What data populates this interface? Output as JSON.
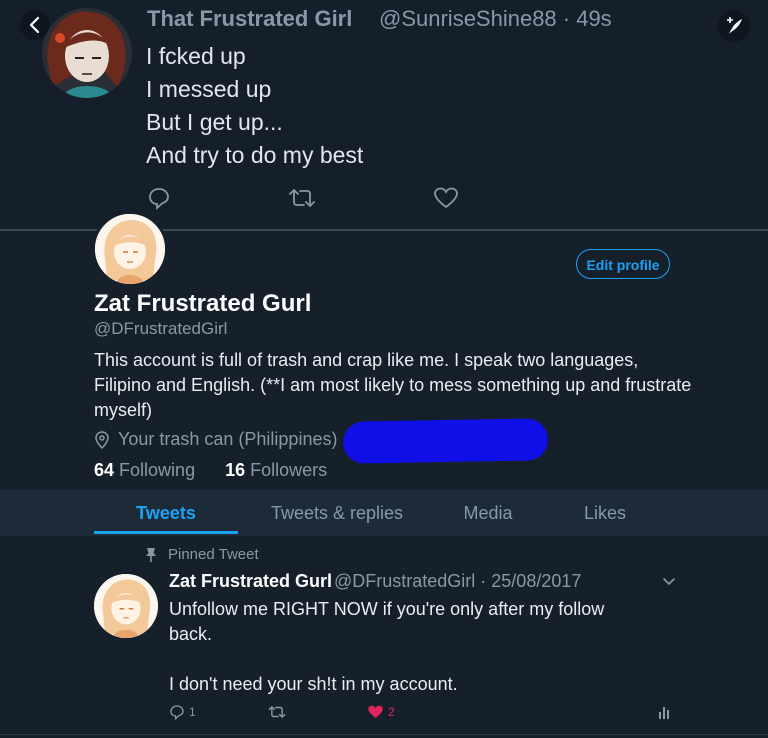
{
  "top_tweet": {
    "author_name": "That Frustrated Girl",
    "handle_time": "@SunriseShine88 · 49s",
    "text": "I fcked up\nI messed up\nBut I get up...\nAnd try to do my best"
  },
  "profile": {
    "display_name": "Zat Frustrated Gurl",
    "handle": "@DFrustratedGirl",
    "bio": "This account is full of trash and crap like me. I speak two languages, Filipino and English. (**I am most likely to mess something up and frustrate myself)",
    "location": "Your trash can (Philippines)",
    "following_count": "64",
    "following_label": "Following",
    "followers_count": "16",
    "followers_label": "Followers",
    "edit_profile_label": "Edit profile"
  },
  "tabs": [
    {
      "label": "Tweets",
      "active": true
    },
    {
      "label": "Tweets & replies",
      "active": false
    },
    {
      "label": "Media",
      "active": false
    },
    {
      "label": "Likes",
      "active": false
    }
  ],
  "pinned_tweet": {
    "pinned_label": "Pinned Tweet",
    "author_name": "Zat Frustrated Gurl",
    "meta": "@DFrustratedGirl · 25/08/2017",
    "text": "Unfollow me RIGHT NOW if you're only after my follow back.\n\nI don't need your sh!t in my account.",
    "reply_count": "1",
    "like_count": "2"
  },
  "colors": {
    "background": "#15202b",
    "accent": "#1da1f2",
    "like": "#e0245e",
    "muted": "#8899a6"
  },
  "icons": [
    "back-arrow-icon",
    "compose-icon",
    "reply-icon",
    "retweet-icon",
    "like-icon",
    "location-icon",
    "pin-icon",
    "chevron-down-icon",
    "analytics-icon"
  ]
}
